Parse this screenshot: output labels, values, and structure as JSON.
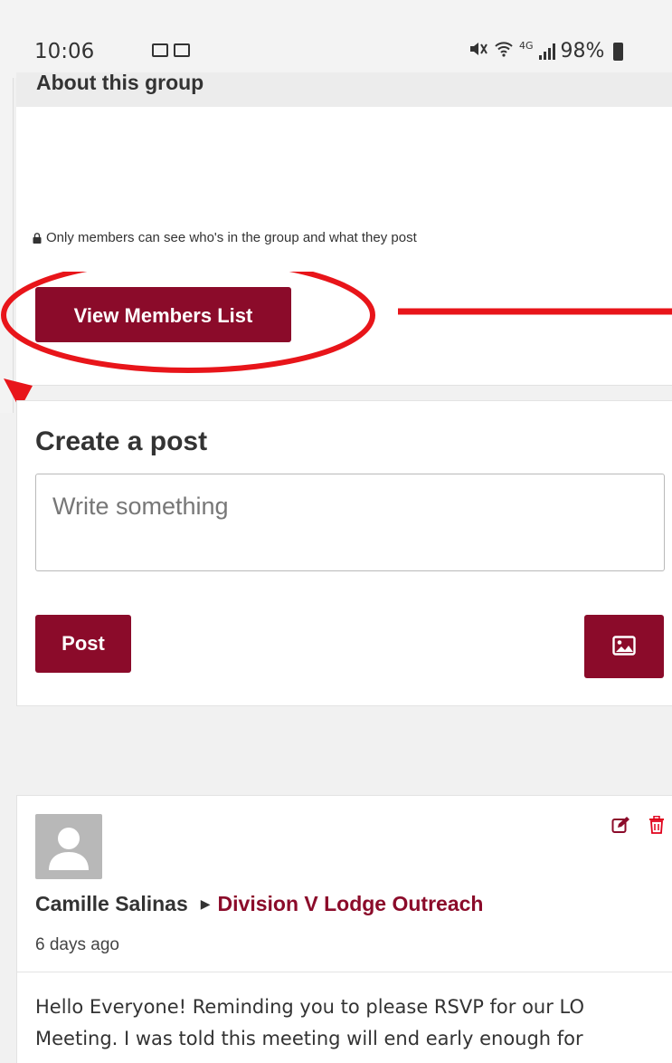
{
  "status_bar": {
    "time": "10:06",
    "network": "4G",
    "battery_percent": "98%"
  },
  "about": {
    "title": "About this group",
    "privacy_note": "Only members can see who's in the group and what they post",
    "view_members_label": "View Members List"
  },
  "create_post": {
    "title": "Create a post",
    "placeholder": "Write something",
    "post_label": "Post"
  },
  "post": {
    "author": "Camille Salinas",
    "group": "Division V Lodge Outreach",
    "time": "6 days ago",
    "body": "Hello Everyone! Reminding you to please RSVP for our LO Meeting. I was told this meeting will end early enough for"
  },
  "colors": {
    "brand": "#8b0b2a",
    "annotation": "#e8151a"
  },
  "icons": [
    "gallery-icon",
    "message-icon",
    "mute-icon",
    "wifi-icon",
    "signal-icon",
    "battery-icon",
    "lock-icon",
    "image-icon",
    "avatar-placeholder-icon",
    "edit-icon",
    "delete-icon",
    "caret-right-icon"
  ]
}
